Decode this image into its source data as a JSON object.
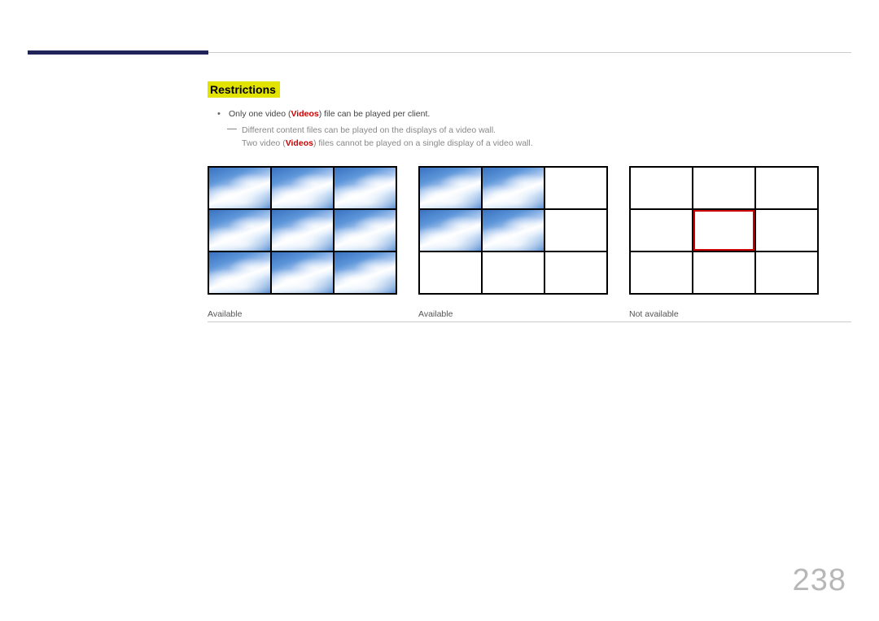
{
  "section_title": "Restrictions",
  "bullet": {
    "prefix": "Only one video (",
    "em": "Videos",
    "suffix": ") file can be played per client."
  },
  "sub1": "Different content files can be played on the displays of a video wall.",
  "sub2": {
    "prefix": "Two video (",
    "em": "Videos",
    "suffix": ") files cannot be played on a single display of a video wall."
  },
  "captions": {
    "fig1": "Available",
    "fig2": "Available",
    "fig3": "Not available"
  },
  "page_number": "238"
}
